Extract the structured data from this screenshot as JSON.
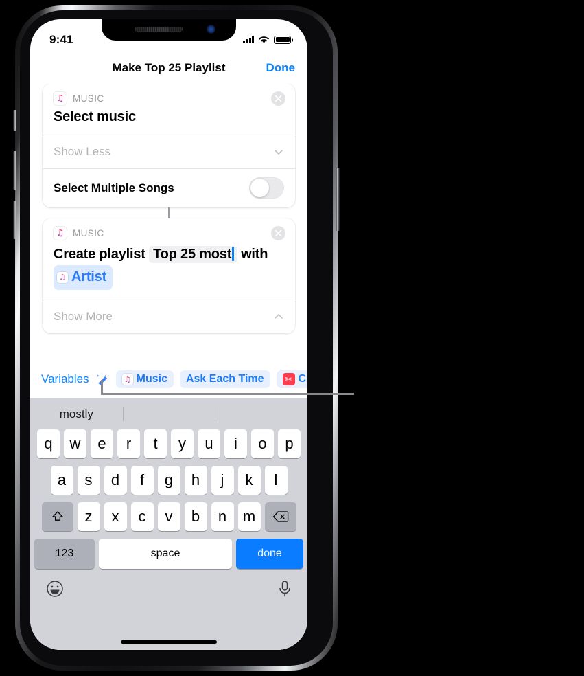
{
  "status_bar": {
    "time": "9:41",
    "signal_icon": "cellular-signal-icon",
    "wifi_icon": "wifi-icon",
    "battery_icon": "battery-full-icon"
  },
  "nav": {
    "title": "Make Top 25 Playlist",
    "done_label": "Done"
  },
  "cards": [
    {
      "app_label": "MUSIC",
      "app_icon": "music-app-icon",
      "close_icon": "close-circle-icon",
      "title": "Select music",
      "disclosure_label": "Show Less",
      "disclosure_icon": "chevron-down-icon",
      "option_label": "Select Multiple Songs",
      "toggle_state": "off"
    },
    {
      "app_label": "MUSIC",
      "app_icon": "music-app-icon",
      "close_icon": "close-circle-icon",
      "sentence_prefix": "Create playlist",
      "field_value": "Top 25 most",
      "sentence_middle": "with",
      "variable_chip": "Artist",
      "variable_chip_icon": "music-app-icon",
      "disclosure_label": "Show More",
      "disclosure_icon": "chevron-up-icon"
    }
  ],
  "variables_bar": {
    "label": "Variables",
    "wand_icon": "magic-wand-icon",
    "chips": [
      {
        "label": "Music",
        "icon": "music-app-icon"
      },
      {
        "label": "Ask Each Time",
        "icon": ""
      },
      {
        "label": "C",
        "icon": "scissors-icon"
      }
    ]
  },
  "keyboard": {
    "predictions": [
      "mostly",
      "",
      ""
    ],
    "row1": [
      "q",
      "w",
      "e",
      "r",
      "t",
      "y",
      "u",
      "i",
      "o",
      "p"
    ],
    "row2": [
      "a",
      "s",
      "d",
      "f",
      "g",
      "h",
      "j",
      "k",
      "l"
    ],
    "row3": [
      "z",
      "x",
      "c",
      "v",
      "b",
      "n",
      "m"
    ],
    "shift_icon": "shift-arrow-icon",
    "delete_icon": "backspace-delete-icon",
    "numbers_label": "123",
    "space_label": "space",
    "return_label": "done",
    "emoji_icon": "emoji-smiley-icon",
    "dictation_icon": "microphone-icon"
  },
  "colors": {
    "accent_blue": "#0a84ff",
    "chip_blue_bg": "#dbeafe",
    "chip_blue_text": "#2f7bf6",
    "keyboard_bg": "#d1d3d9",
    "done_key_blue": "#0a7cff",
    "scissors_red": "#ff3b4e"
  }
}
